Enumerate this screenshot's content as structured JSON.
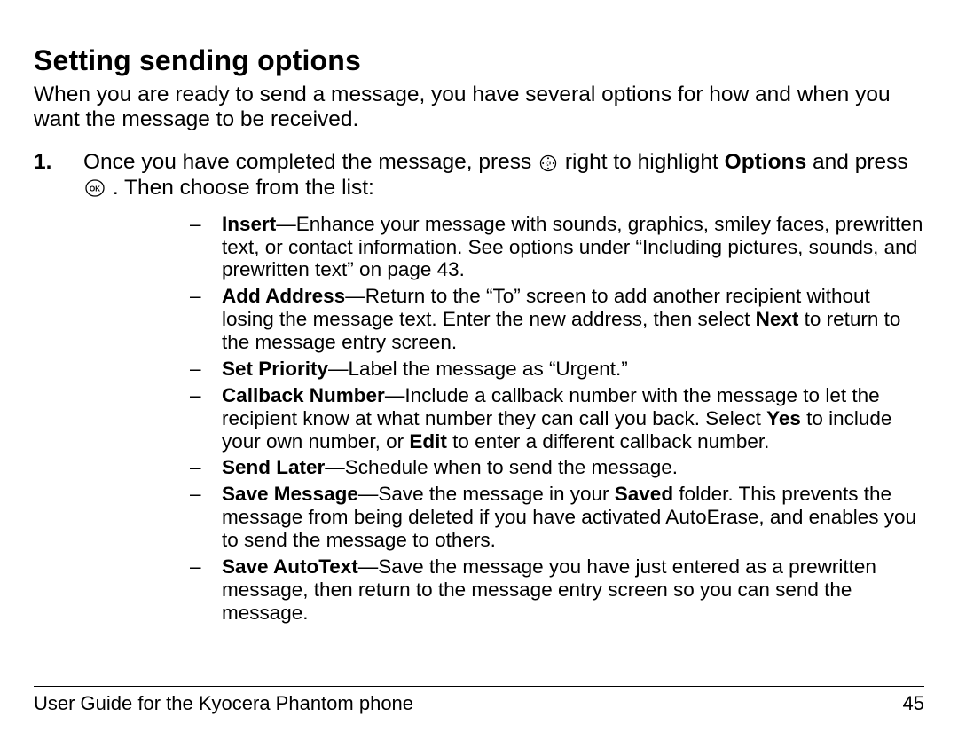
{
  "heading": "Setting sending options",
  "intro": "When you are ready to send a message, you have several options for how and when you want the message to be received.",
  "step": {
    "number": "1.",
    "part1": "Once you have completed the message, press ",
    "part2": " right to highlight ",
    "options_word": "Options",
    "part3": " and press ",
    "part4": " . Then choose from the list:"
  },
  "options": [
    {
      "term": "Insert",
      "body": "—Enhance your message with sounds, graphics, smiley faces, prewritten text, or contact information. See options under “Including pictures, sounds, and prewritten text” on page 43."
    },
    {
      "term": "Add Address",
      "body_pre": "—Return to the “To” screen to add another recipient without losing the message text. Enter the new address, then select ",
      "bold1": "Next",
      "body_post": " to return to the message entry screen."
    },
    {
      "term": "Set Priority",
      "body": "—Label the message as “Urgent.”"
    },
    {
      "term": "Callback Number",
      "body_pre": "—Include a callback number with the message to let the recipient know at what number they can call you back. Select ",
      "bold1": "Yes",
      "body_mid": " to include your own number, or ",
      "bold2": "Edit",
      "body_post": " to enter a different callback number."
    },
    {
      "term": "Send Later",
      "body": "—Schedule when to send the message."
    },
    {
      "term": "Save Message",
      "body_pre": "—Save the message in your ",
      "bold1": "Saved",
      "body_post": " folder. This prevents the message from being deleted if you have activated AutoErase, and enables you to send the message to others."
    },
    {
      "term": "Save AutoText",
      "body": "—Save the message you have just entered as a prewritten message, then return to the message entry screen so you can send the message."
    }
  ],
  "footer": {
    "left": "User Guide for the Kyocera Phantom phone",
    "right": "45"
  }
}
